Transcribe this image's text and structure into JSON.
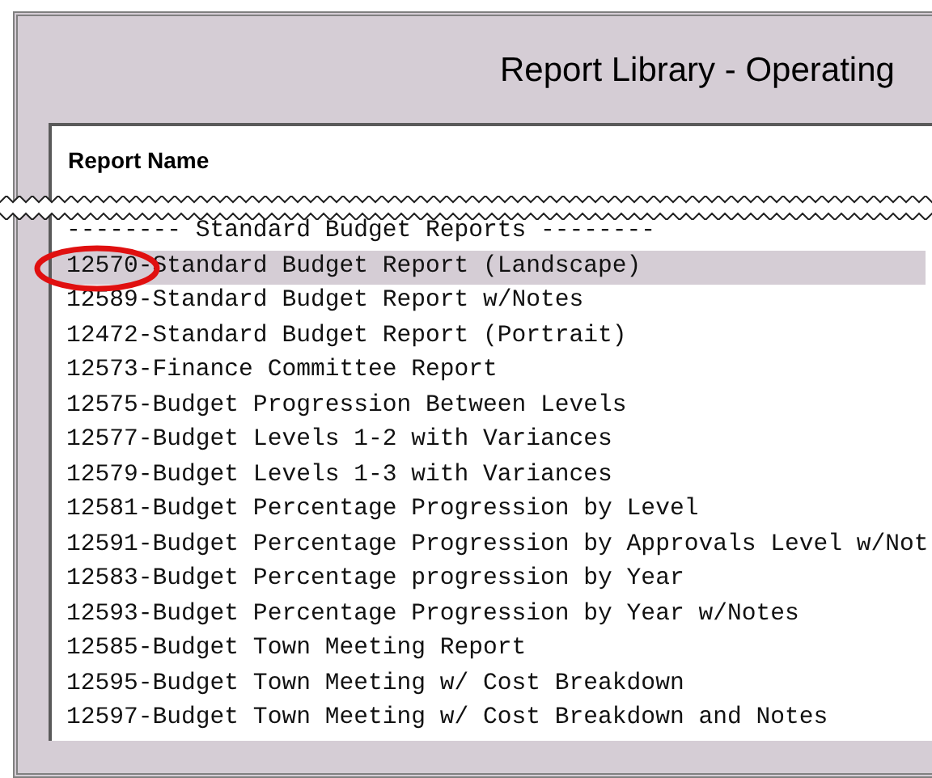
{
  "window": {
    "title": "Report Library - Operating"
  },
  "list": {
    "header": "Report Name",
    "rows": [
      {
        "label": "-------- Standard Budget Reports --------",
        "selected": false
      },
      {
        "label": "12570-Standard Budget Report (Landscape)",
        "selected": true
      },
      {
        "label": "12589-Standard Budget Report w/Notes",
        "selected": false
      },
      {
        "label": "12472-Standard Budget Report (Portrait)",
        "selected": false
      },
      {
        "label": "12573-Finance Committee Report",
        "selected": false
      },
      {
        "label": "12575-Budget Progression Between Levels",
        "selected": false
      },
      {
        "label": "12577-Budget Levels 1-2 with Variances",
        "selected": false
      },
      {
        "label": "12579-Budget Levels 1-3 with Variances",
        "selected": false
      },
      {
        "label": "12581-Budget Percentage Progression by Level",
        "selected": false
      },
      {
        "label": "12591-Budget Percentage Progression by Approvals Level w/Not",
        "selected": false
      },
      {
        "label": "12583-Budget Percentage progression by Year",
        "selected": false
      },
      {
        "label": "12593-Budget Percentage Progression by Year w/Notes",
        "selected": false
      },
      {
        "label": "12585-Budget Town Meeting Report",
        "selected": false
      },
      {
        "label": "12595-Budget Town Meeting w/ Cost Breakdown",
        "selected": false
      },
      {
        "label": "12597-Budget Town Meeting w/ Cost Breakdown and Notes",
        "selected": false
      }
    ]
  }
}
